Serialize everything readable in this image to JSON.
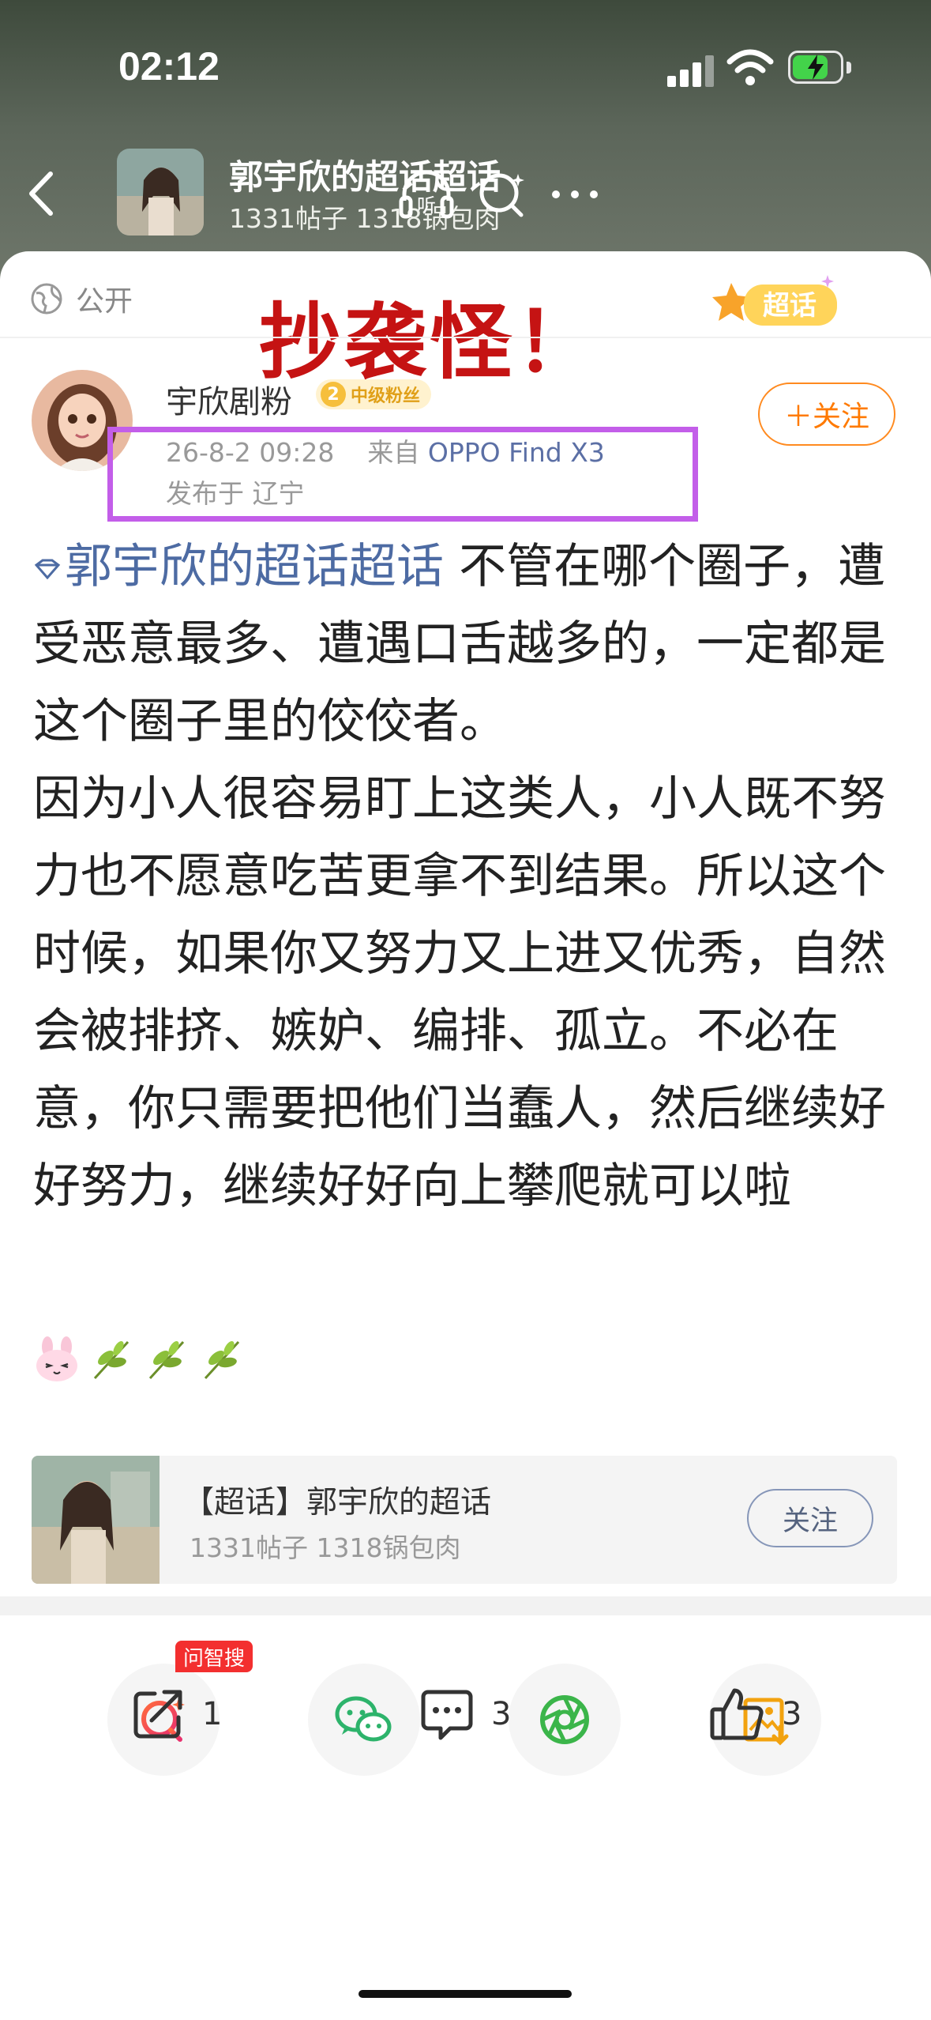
{
  "status_bar": {
    "time": "02:12"
  },
  "nav": {
    "topic_title": "郭宇欣的超话超话",
    "topic_stats": "1331帖子 1318锅包肉",
    "listen_label": "听"
  },
  "post": {
    "visibility": "公开",
    "overlay_text": "抄袭怪！",
    "badge_text": "超话",
    "author": {
      "name": "宇欣剧粉",
      "fan_level": "2",
      "fan_badge": "中级粉丝",
      "date": "26-8-2 09:28",
      "source_prefix": "来自",
      "device": "OPPO Find X3",
      "location": "发布于 辽宁"
    },
    "follow_label": "＋关注",
    "topic_tag": "郭宇欣的超话超话",
    "body_text": " 不管在哪个圈子，遭受恶意最多、遭遇口舌越多的，一定都是这个圈子里的佼佼者。\n因为小人很容易盯上这类人，小人既不努力也不愿意吃苦更拿不到结果。所以这个时候，如果你又努力又上进又优秀，自然会被排挤、嫉妒、编排、孤立。不必在意，你只需要把他们当蠢人，然后继续好好努力，继续好好向上攀爬就可以啦"
  },
  "topic_card": {
    "name": "【超话】郭宇欣的超话",
    "stats": "1331帖子 1318锅包肉",
    "follow_label": "关注"
  },
  "share": {
    "ask_tag": "问智搜"
  },
  "actions": {
    "repost_count": "1",
    "comment_count": "3",
    "like_count": "3"
  },
  "colors": {
    "accent_orange": "#ff7a00",
    "overlay_red": "#c51313",
    "highlight_purple": "#c35ee9",
    "topic_link": "#4d6ba3"
  }
}
